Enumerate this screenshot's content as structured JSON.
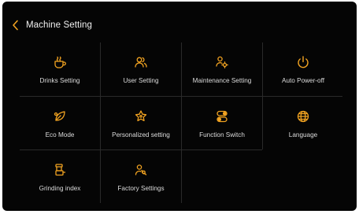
{
  "header": {
    "title": "Machine Setting",
    "back_icon": "chevron-left-icon"
  },
  "colors": {
    "accent": "#f2a321",
    "background": "#050505",
    "divider": "#2a2a2a",
    "text": "#dcdcdc"
  },
  "menu": {
    "items": [
      {
        "label": "Drinks Setting",
        "icon": "coffee-cup-icon"
      },
      {
        "label": "User Setting",
        "icon": "users-icon"
      },
      {
        "label": "Maintenance Setting",
        "icon": "maintenance-icon"
      },
      {
        "label": "Auto Power-off",
        "icon": "power-icon"
      },
      {
        "label": "Eco Mode",
        "icon": "eco-leaf-icon"
      },
      {
        "label": "Personalized setting",
        "icon": "personalize-star-icon"
      },
      {
        "label": "Function Switch",
        "icon": "toggle-switch-icon"
      },
      {
        "label": "Language",
        "icon": "globe-icon"
      },
      {
        "label": "Grinding index",
        "icon": "grinder-icon"
      },
      {
        "label": "Factory Settings",
        "icon": "wrench-person-icon"
      }
    ]
  }
}
